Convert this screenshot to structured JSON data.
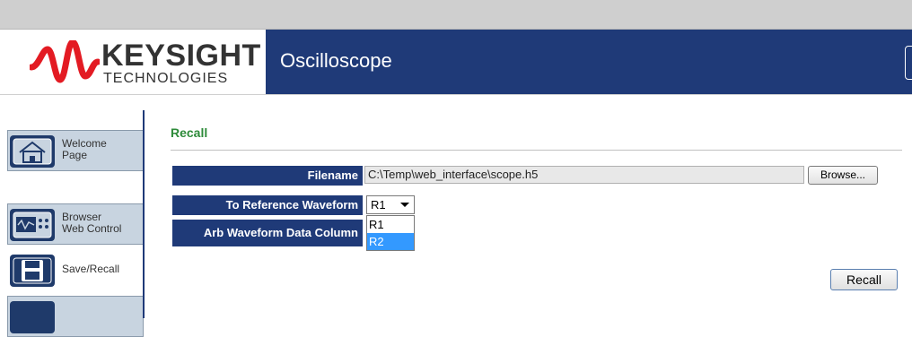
{
  "brand": {
    "name": "KEYSIGHT",
    "sub": "TECHNOLOGIES",
    "color": "#e31b23"
  },
  "app": {
    "title": "Oscilloscope",
    "bar_color": "#1f3a78"
  },
  "sidebar": {
    "items": [
      {
        "label": "Welcome\nPage",
        "icon": "home-icon"
      },
      {
        "label": "Browser\nWeb Control",
        "icon": "instrument-icon"
      },
      {
        "label": "Save/Recall",
        "icon": "floppy-disk-icon",
        "active": true
      },
      {
        "label": "",
        "icon": "settings-icon"
      }
    ]
  },
  "main": {
    "section_title": "Recall",
    "fields": {
      "filename_label": "Filename",
      "filename_value": "C:\\Temp\\web_interface\\scope.h5",
      "browse_label": "Browse...",
      "ref_label": "To Reference Waveform",
      "ref_value": "R1",
      "ref_options": [
        "R1",
        "R2"
      ],
      "ref_highlighted": "R2",
      "arb_label": "Arb Waveform Data Column"
    },
    "recall_button": "Recall"
  }
}
